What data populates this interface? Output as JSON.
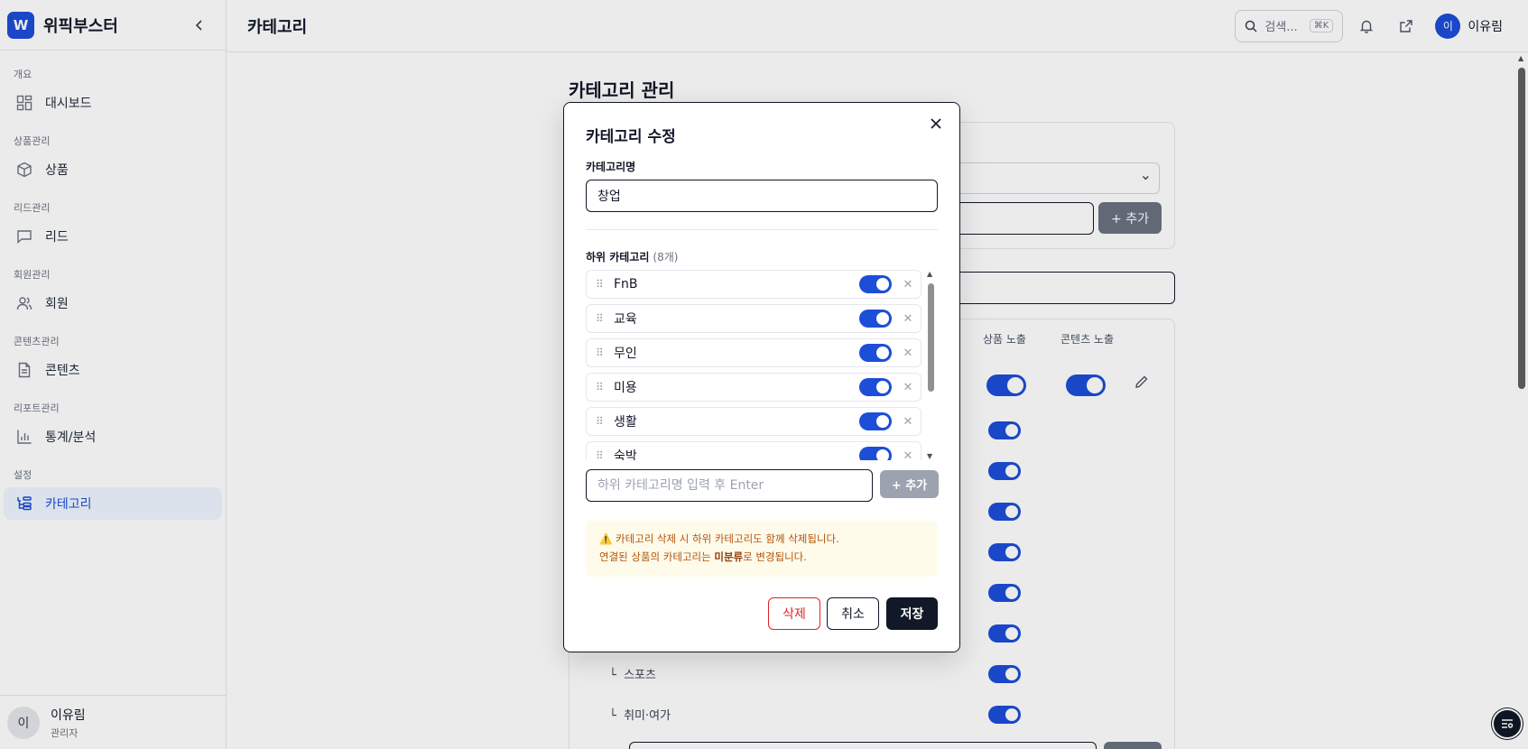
{
  "brand": {
    "logo_letter": "W",
    "name": "위픽부스터"
  },
  "sidebar": {
    "groups": [
      {
        "title": "개요",
        "item": "대시보드",
        "icon": "dashboard-icon"
      },
      {
        "title": "상품관리",
        "item": "상품",
        "icon": "box-icon"
      },
      {
        "title": "리드관리",
        "item": "리드",
        "icon": "chat-icon"
      },
      {
        "title": "회원관리",
        "item": "회원",
        "icon": "users-icon"
      },
      {
        "title": "콘텐츠관리",
        "item": "콘텐츠",
        "icon": "document-icon"
      },
      {
        "title": "리포트관리",
        "item": "통계/분석",
        "icon": "bar-chart-icon"
      },
      {
        "title": "설정",
        "item": "카테고리",
        "icon": "category-tree-icon",
        "active": true
      }
    ],
    "user": {
      "initial": "이",
      "name": "이유림",
      "role": "관리자"
    }
  },
  "topbar": {
    "title": "카테고리",
    "search_placeholder": "검색...",
    "search_shortcut": "⌘K",
    "user_initial": "이",
    "user_name": "이유림"
  },
  "background": {
    "title": "카테고리 관리",
    "add_label": "+ 추가",
    "col_product": "상품 노출",
    "col_content": "콘텐츠 노출",
    "rows": [
      "스포츠",
      "취미·여가"
    ]
  },
  "modal": {
    "title": "카테고리 수정",
    "name_label": "카테고리명",
    "name_value": "창업",
    "sub_label": "하위 카테고리",
    "sub_count": "(8개)",
    "sub_items": [
      "FnB",
      "교육",
      "무인",
      "미용",
      "생활",
      "숙박"
    ],
    "sub_placeholder": "하위 카테고리명 입력 후 Enter",
    "sub_add": "+ 추가",
    "warn_line1": "카테고리 삭제 시 하위 카테고리도 함께 삭제됩니다.",
    "warn_line2_pre": "연결된 상품의 카테고리는 ",
    "warn_line2_bold": "미분류",
    "warn_line2_post": "로 변경됩니다.",
    "delete_label": "삭제",
    "cancel_label": "취소",
    "save_label": "저장"
  },
  "colors": {
    "accent": "#1d4ed8",
    "danger": "#dc2626",
    "warning_bg": "#fffbeb",
    "warning_text": "#b45309"
  }
}
